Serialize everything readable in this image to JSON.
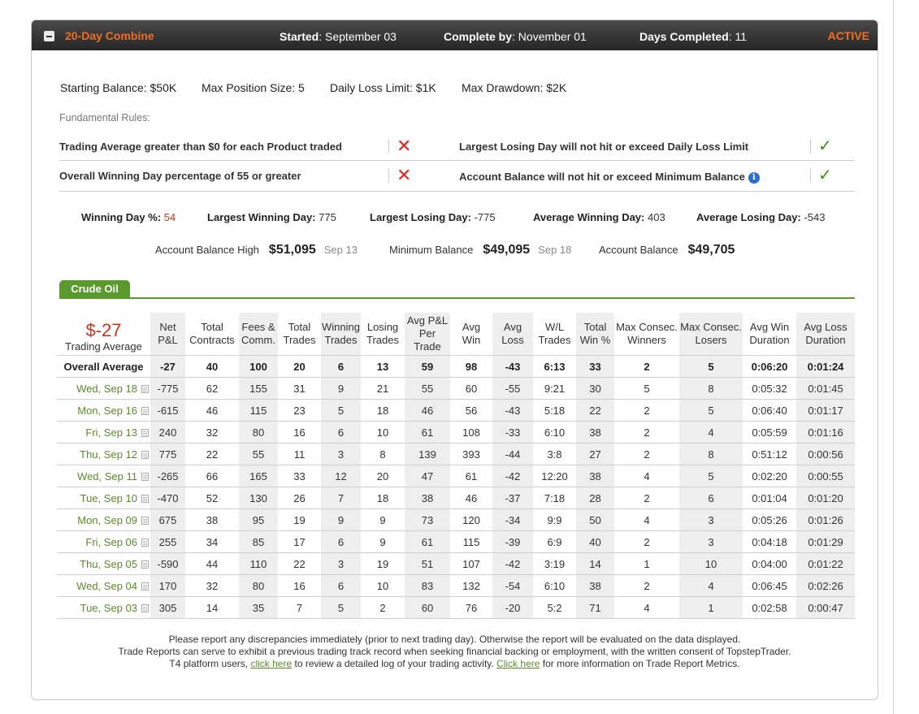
{
  "header": {
    "title": "20-Day Combine",
    "started_label": "Started",
    "started_value": ": September 03",
    "complete_label": "Complete by",
    "complete_value": ": November 01",
    "days_label": "Days Completed",
    "days_value": ": 11",
    "status": "ACTIVE"
  },
  "limits": {
    "starting_balance": "Starting Balance: $50K",
    "max_position": "Max Position Size: 5",
    "daily_loss": "Daily Loss Limit: $1K",
    "max_drawdown": "Max Drawdown: $2K"
  },
  "fundamental_label": "Fundamental Rules:",
  "rules": {
    "r1": "Trading Average greater than $0 for each Product traded",
    "r2": "Overall Winning Day percentage of 55 or greater",
    "r3": "Largest Losing Day will not hit or exceed Daily Loss Limit",
    "r4": "Account Balance will not hit or exceed Minimum Balance",
    "r1_status": "fail",
    "r2_status": "fail",
    "r3_status": "pass",
    "r4_status": "pass"
  },
  "stats": {
    "win_pct_label": "Winning Day %:",
    "win_pct": "54",
    "largest_win_label": "Largest Winning Day:",
    "largest_win": "775",
    "largest_loss_label": "Largest Losing Day:",
    "largest_loss": "-775",
    "avg_win_label": "Average Winning Day:",
    "avg_win": "403",
    "avg_loss_label": "Average Losing Day:",
    "avg_loss": "-543"
  },
  "balances": {
    "high_label": "Account Balance High",
    "high_amount": "$51,095",
    "high_date": "Sep 13",
    "min_label": "Minimum Balance",
    "min_amount": "$49,095",
    "min_date": "Sep 18",
    "bal_label": "Account Balance",
    "bal_amount": "$49,705"
  },
  "product_tab": "Crude Oil",
  "table": {
    "trading_average": "$-27",
    "trading_average_label": "Trading Average",
    "columns": [
      [
        "Net",
        "P&L"
      ],
      [
        "Total",
        "Contracts"
      ],
      [
        "Fees &",
        "Comm."
      ],
      [
        "Total",
        "Trades"
      ],
      [
        "Winning",
        "Trades"
      ],
      [
        "Losing",
        "Trades"
      ],
      [
        "Avg P&L",
        "Per Trade"
      ],
      [
        "Avg",
        "Win"
      ],
      [
        "Avg",
        "Loss"
      ],
      [
        "W/L",
        "Trades"
      ],
      [
        "Total",
        "Win %"
      ],
      [
        "Max Consec.",
        "Winners"
      ],
      [
        "Max Consec.",
        "Losers"
      ],
      [
        "Avg Win",
        "Duration"
      ],
      [
        "Avg Loss",
        "Duration"
      ]
    ],
    "overall": {
      "label": "Overall Average",
      "values": [
        "-27",
        "40",
        "100",
        "20",
        "6",
        "13",
        "59",
        "98",
        "-43",
        "6:13",
        "33",
        "2",
        "5",
        "0:06:20",
        "0:01:24"
      ]
    },
    "rows": [
      {
        "date": "Wed, Sep 18",
        "values": [
          "-775",
          "62",
          "155",
          "31",
          "9",
          "21",
          "55",
          "60",
          "-55",
          "9:21",
          "30",
          "5",
          "8",
          "0:05:32",
          "0:01:45"
        ]
      },
      {
        "date": "Mon, Sep 16",
        "values": [
          "-615",
          "46",
          "115",
          "23",
          "5",
          "18",
          "46",
          "56",
          "-43",
          "5:18",
          "22",
          "2",
          "5",
          "0:06:40",
          "0:01:17"
        ]
      },
      {
        "date": "Fri, Sep 13",
        "values": [
          "240",
          "32",
          "80",
          "16",
          "6",
          "10",
          "61",
          "108",
          "-33",
          "6:10",
          "38",
          "2",
          "4",
          "0:05:59",
          "0:01:16"
        ]
      },
      {
        "date": "Thu, Sep 12",
        "values": [
          "775",
          "22",
          "55",
          "11",
          "3",
          "8",
          "139",
          "393",
          "-44",
          "3:8",
          "27",
          "2",
          "8",
          "0:51:12",
          "0:00:56"
        ]
      },
      {
        "date": "Wed, Sep 11",
        "values": [
          "-265",
          "66",
          "165",
          "33",
          "12",
          "20",
          "47",
          "61",
          "-42",
          "12:20",
          "38",
          "4",
          "5",
          "0:02:20",
          "0:00:55"
        ]
      },
      {
        "date": "Tue, Sep 10",
        "values": [
          "-470",
          "52",
          "130",
          "26",
          "7",
          "18",
          "38",
          "46",
          "-37",
          "7:18",
          "28",
          "2",
          "6",
          "0:01:04",
          "0:01:20"
        ]
      },
      {
        "date": "Mon, Sep 09",
        "values": [
          "675",
          "38",
          "95",
          "19",
          "9",
          "9",
          "73",
          "120",
          "-34",
          "9:9",
          "50",
          "4",
          "3",
          "0:05:26",
          "0:01:26"
        ]
      },
      {
        "date": "Fri, Sep 06",
        "values": [
          "255",
          "34",
          "85",
          "17",
          "6",
          "9",
          "61",
          "115",
          "-39",
          "6:9",
          "40",
          "2",
          "3",
          "0:04:18",
          "0:01:29"
        ]
      },
      {
        "date": "Thu, Sep 05",
        "values": [
          "-590",
          "44",
          "110",
          "22",
          "3",
          "19",
          "51",
          "107",
          "-42",
          "3:19",
          "14",
          "1",
          "10",
          "0:04:00",
          "0:01:22"
        ]
      },
      {
        "date": "Wed, Sep 04",
        "values": [
          "170",
          "32",
          "80",
          "16",
          "6",
          "10",
          "83",
          "132",
          "-54",
          "6:10",
          "38",
          "2",
          "4",
          "0:06:45",
          "0:02:26"
        ]
      },
      {
        "date": "Tue, Sep 03",
        "values": [
          "305",
          "14",
          "35",
          "7",
          "5",
          "2",
          "60",
          "76",
          "-20",
          "5:2",
          "71",
          "4",
          "1",
          "0:02:58",
          "0:00:47"
        ]
      }
    ]
  },
  "footer": {
    "line1": "Please report any discrepancies immediately (prior to next trading day). Otherwise the report will be evaluated on the data displayed.",
    "line2": "Trade Reports can serve to exhibit a previous trading track record when seeking financial backing or employment, with the written consent of TopstepTrader.",
    "line3_a": "T4 platform users,",
    "link1": "click here",
    "line3_b": "to review a detailed log of your trading activity.",
    "link2": "Click here",
    "line3_c": "for more information on Trade Report Metrics."
  },
  "colors": {
    "accent_orange": "#f26d21",
    "green": "#5a9a2c",
    "red": "#c8331e",
    "check_green": "#3d8f19",
    "x_red": "#e0281d"
  }
}
